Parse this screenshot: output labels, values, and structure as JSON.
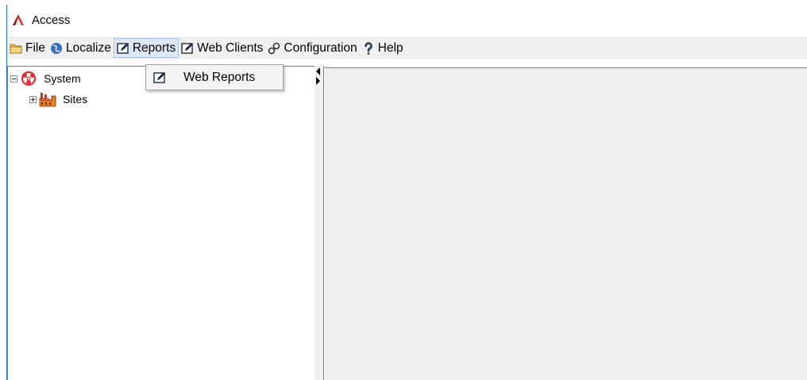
{
  "window": {
    "title": "Access"
  },
  "menubar": {
    "items": [
      {
        "label": "File",
        "icon": "folder-icon"
      },
      {
        "label": "Localize",
        "icon": "globe-icon"
      },
      {
        "label": "Reports",
        "icon": "edit-icon"
      },
      {
        "label": "Web Clients",
        "icon": "edit-icon"
      },
      {
        "label": "Configuration",
        "icon": "link-icon"
      },
      {
        "label": "Help",
        "icon": "help-icon"
      }
    ],
    "active": "Reports"
  },
  "reports_menu": {
    "items": [
      {
        "label": "Web Reports",
        "icon": "edit-icon"
      }
    ]
  },
  "tree": {
    "root": {
      "label": "System",
      "icon": "system-icon",
      "expanded": true
    },
    "children": [
      {
        "label": "Sites",
        "icon": "factory-icon",
        "expanded": false
      }
    ]
  },
  "colors": {
    "menu_highlight": "#dde8f6",
    "menu_highlight_border": "#a8c6ec",
    "content_bg": "#f0f0f0",
    "window_border": "#1f6fd6"
  }
}
